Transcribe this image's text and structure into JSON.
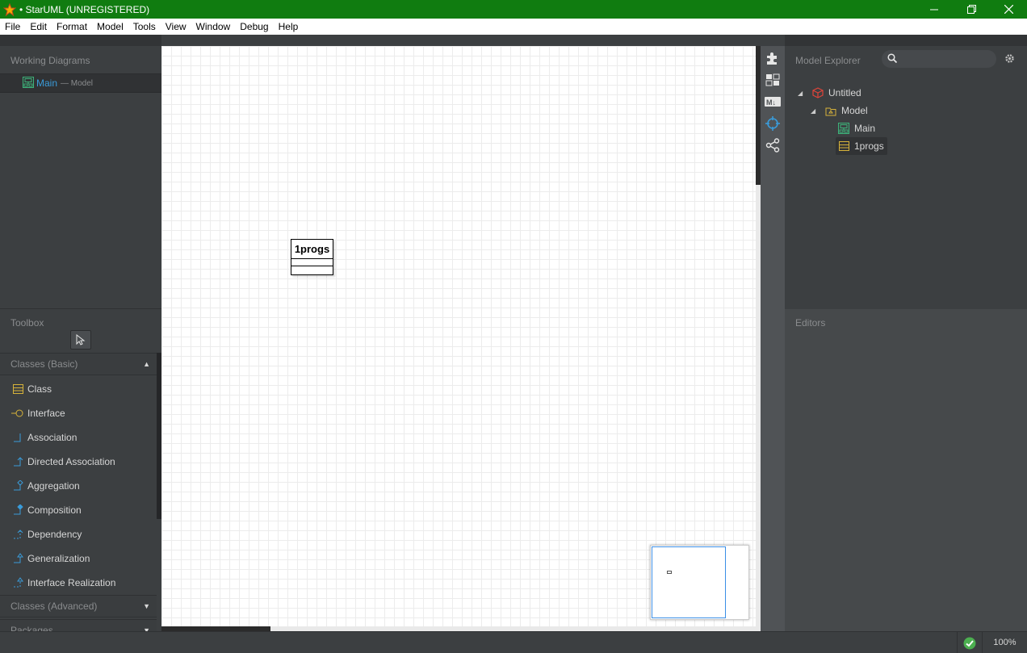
{
  "window": {
    "title": "• StarUML (UNREGISTERED)",
    "minimize_symbol": "—",
    "restore_symbol": "❐",
    "close_symbol": "✕",
    "title_bar_color": "#107c10"
  },
  "menu": [
    "File",
    "Edit",
    "Format",
    "Model",
    "Tools",
    "View",
    "Window",
    "Debug",
    "Help"
  ],
  "working_diagrams": {
    "title": "Working Diagrams",
    "items": [
      {
        "name": "Main",
        "sub": "— Model",
        "icon": "class-diagram-icon"
      }
    ]
  },
  "toolbox": {
    "title": "Toolbox",
    "sections": [
      {
        "label": "Classes (Basic)",
        "expanded": true,
        "items": [
          {
            "label": "Class",
            "icon": "class-icon"
          },
          {
            "label": "Interface",
            "icon": "interface-icon"
          },
          {
            "label": "Association",
            "icon": "association-icon"
          },
          {
            "label": "Directed Association",
            "icon": "directed-association-icon"
          },
          {
            "label": "Aggregation",
            "icon": "aggregation-icon"
          },
          {
            "label": "Composition",
            "icon": "composition-icon"
          },
          {
            "label": "Dependency",
            "icon": "dependency-icon"
          },
          {
            "label": "Generalization",
            "icon": "generalization-icon"
          },
          {
            "label": "Interface Realization",
            "icon": "interface-realization-icon"
          }
        ]
      },
      {
        "label": "Classes (Advanced)",
        "expanded": false
      },
      {
        "label": "Packages",
        "expanded": false
      }
    ]
  },
  "diagram": {
    "class_name": "1progs"
  },
  "model_explorer": {
    "title": "Model Explorer",
    "search_placeholder": "",
    "tree": [
      {
        "label": "Untitled",
        "icon": "project-icon",
        "expanded": true
      },
      {
        "label": "Model",
        "icon": "model-icon",
        "expanded": true
      },
      {
        "label": "Main",
        "icon": "class-diagram-icon"
      },
      {
        "label": "1progs",
        "icon": "class-icon",
        "selected": true
      }
    ]
  },
  "editors": {
    "title": "Editors"
  },
  "status": {
    "zoom": "100%",
    "validation": "ok"
  },
  "colors": {
    "accent_blue": "#3a9bd9",
    "icon_yellow": "#d6b23a",
    "icon_green": "#3db37a",
    "icon_red": "#e0443a",
    "ok_green": "#4caf50"
  }
}
